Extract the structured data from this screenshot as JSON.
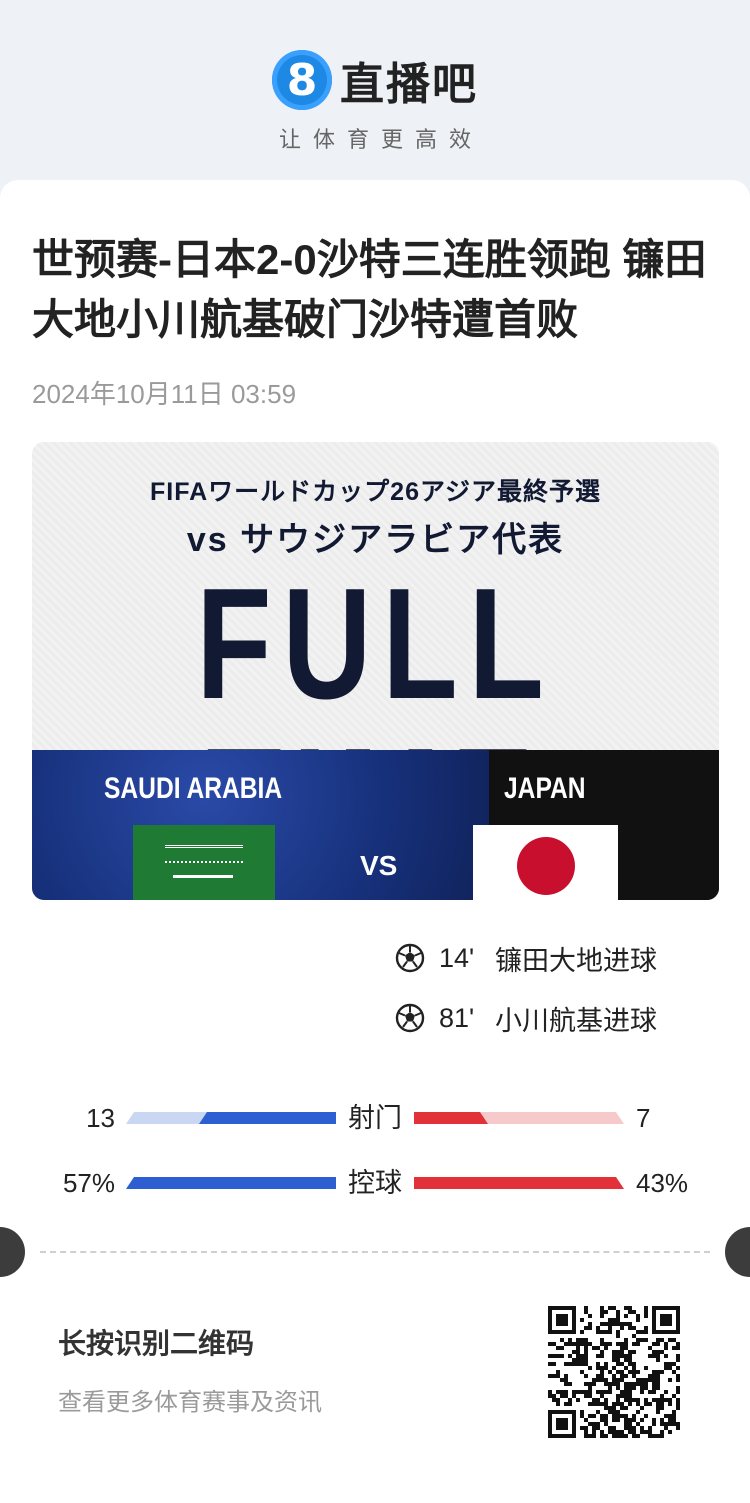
{
  "brand": {
    "logo_glyph": "8",
    "name": "直播吧",
    "slogan": "让体育更高效",
    "accent_color": "#1e88e5"
  },
  "article": {
    "title": "世预赛-日本2-0沙特三连胜领跑 镰田大地小川航基破门沙特遭首败",
    "date": "2024年10月11日 03:59"
  },
  "graphic": {
    "line1": "FIFAワールドカップ26アジア最終予選",
    "line2": "vs サウジアラビア代表",
    "headline": "FULL TIME",
    "home_team": "SAUDI ARABIA",
    "away_team": "JAPAN",
    "vs": "VS"
  },
  "goals": [
    {
      "icon": "soccer-ball-icon",
      "minute": "14'",
      "text": "镰田大地进球"
    },
    {
      "icon": "soccer-ball-icon",
      "minute": "81'",
      "text": "小川航基进球"
    }
  ],
  "stats": [
    {
      "label": "射门",
      "left_value": "13",
      "right_value": "7",
      "left_fraction": 0.65,
      "right_fraction": 0.35
    },
    {
      "label": "控球",
      "left_value": "57%",
      "right_value": "43%",
      "left_fraction": 1.0,
      "right_fraction": 1.0
    }
  ],
  "footer": {
    "qr_title": "长按识别二维码",
    "qr_subtitle": "查看更多体育赛事及资讯",
    "qr_icon": "qr-code-icon"
  },
  "colors": {
    "left_bar": "#2d5fd3",
    "left_bar_bg": "#c9d7f3",
    "right_bar": "#e3313a",
    "right_bar_bg": "#f6caca"
  }
}
